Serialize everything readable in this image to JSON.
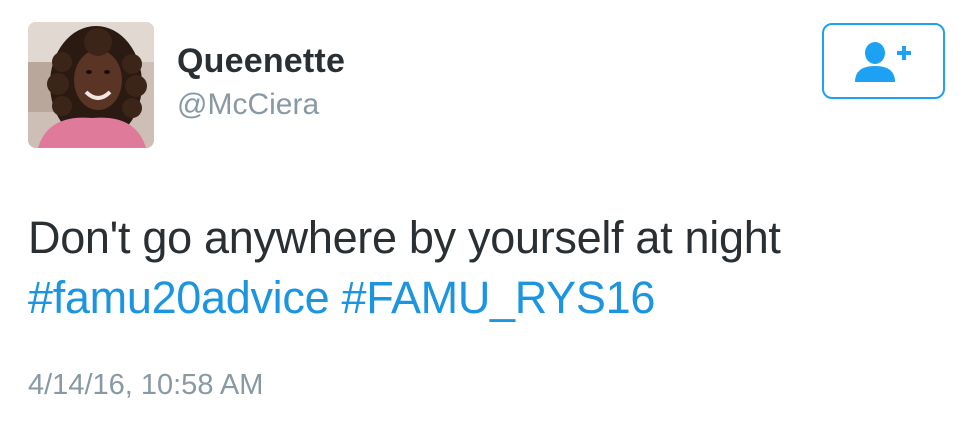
{
  "user": {
    "display_name": "Queenette",
    "handle": "@McCiera"
  },
  "follow_button": {
    "icon": "follow-person-plus-icon"
  },
  "tweet": {
    "text": "Don't go anywhere by yourself at night",
    "hashtags": [
      "#famu20advice",
      "#FAMU_RYS16"
    ],
    "timestamp": "4/14/16, 10:58 AM"
  },
  "colors": {
    "accent": "#1da1f2",
    "hashtag": "#1b95e0",
    "text": "#292f33",
    "secondary": "#8899a6"
  }
}
